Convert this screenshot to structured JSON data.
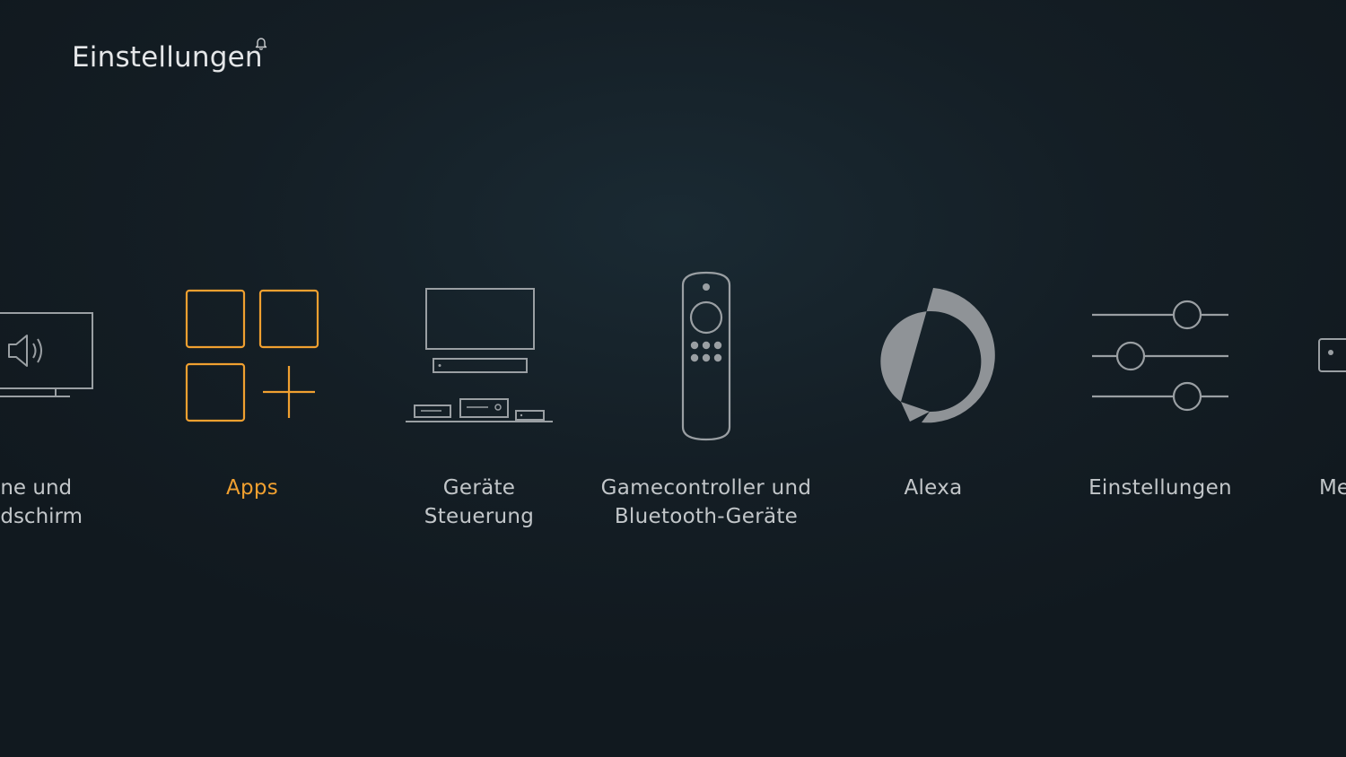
{
  "header": {
    "title": "Einstellungen",
    "notification_icon": "bell-icon"
  },
  "menu": {
    "items": [
      {
        "label": "ne und\ndschirm",
        "icon": "tv-speaker-icon"
      },
      {
        "label": "Apps",
        "icon": "apps-grid-icon",
        "selected": true
      },
      {
        "label": "Geräte\nSteuerung",
        "icon": "devices-icon"
      },
      {
        "label": "Gamecontroller und\nBluetooth-Geräte",
        "icon": "remote-icon"
      },
      {
        "label": "Alexa",
        "icon": "alexa-icon"
      },
      {
        "label": "Einstellungen",
        "icon": "sliders-icon"
      },
      {
        "label": "Me",
        "icon": "device-icon"
      }
    ]
  },
  "colors": {
    "accent": "#f0a030",
    "icon": "#9a9fa3",
    "text": "#c2c6c9"
  }
}
